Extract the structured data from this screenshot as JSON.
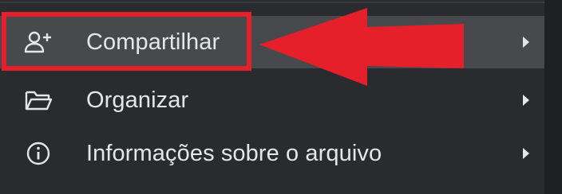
{
  "menu": {
    "items": [
      {
        "label": "Compartilhar",
        "icon": "person-add-icon",
        "has_submenu": true,
        "highlighted": true
      },
      {
        "label": "Organizar",
        "icon": "folder-open-icon",
        "has_submenu": true,
        "highlighted": false
      },
      {
        "label": "Informações sobre o arquivo",
        "icon": "info-icon",
        "has_submenu": true,
        "highlighted": false
      }
    ]
  },
  "annotation": {
    "color": "#e5202a",
    "target": "Compartilhar"
  },
  "colors": {
    "menu_background": "#2a2b2e",
    "highlight_background": "#47494d",
    "text": "#e4e6ea"
  }
}
